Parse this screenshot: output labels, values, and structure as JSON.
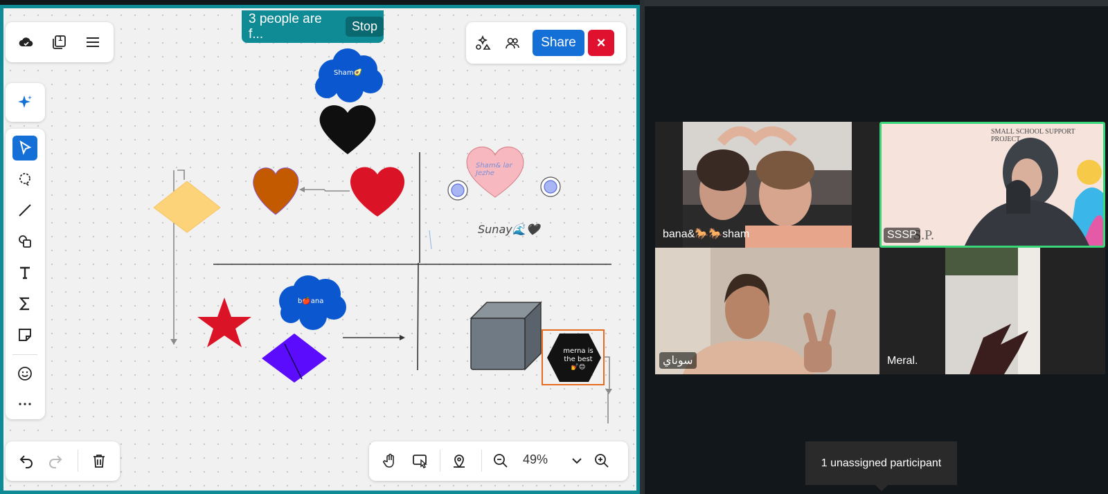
{
  "toolbar_top": {
    "save_icon": "cloud-save-icon",
    "pages_badge": "1",
    "menu_icon": "hamburger-menu-icon"
  },
  "follow_banner": {
    "text": "3 people are f...",
    "stop_label": "Stop"
  },
  "actions": {
    "share_label": "Share",
    "close_symbol": "×"
  },
  "left_tools": [
    "cursor-icon",
    "lasso-icon",
    "line-icon",
    "shapes-icon",
    "text-icon",
    "formula-icon",
    "sticky-note-icon",
    "emoji-icon",
    "more-icon"
  ],
  "bottom_left": {
    "undo": "undo-icon",
    "redo": "redo-icon",
    "delete": "trash-icon"
  },
  "bottom_right": {
    "zoom": "49%"
  },
  "scene": {
    "cloud1_text": "Sham🥑",
    "cloud2_text": "b🍎ana",
    "heart_text": "Sham& lar\nJezhe",
    "sunay_text": "Sunay🌊🖤",
    "hex_text_line1": "merna is",
    "hex_text_line2": "the best",
    "hex_text_line3": "💅😊"
  },
  "participants": [
    {
      "name": "bana&🐎🐎sham"
    },
    {
      "name": "SSSP",
      "overlay": "SMALL SCHOOL SUPPORT PROJECT",
      "extra": "S.P."
    },
    {
      "name": "سوناي"
    },
    {
      "name": "Meral."
    }
  ],
  "unassigned": "1 unassigned participant",
  "colors": {
    "brand_teal": "#0f8b96",
    "share_blue": "#1470d6",
    "close_red": "#e0102f",
    "active_speaker": "#3ad77a"
  }
}
